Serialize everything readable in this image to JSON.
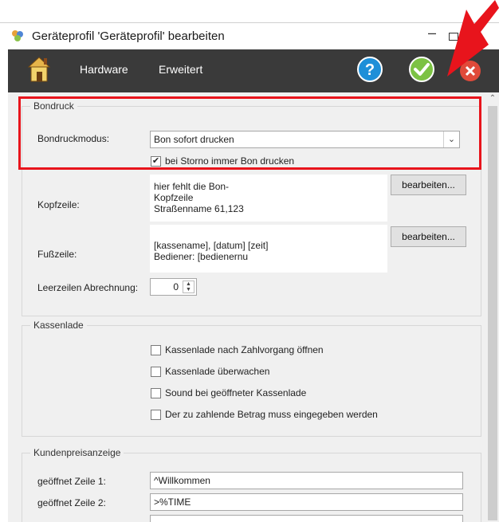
{
  "window": {
    "title": "Geräteprofil 'Geräteprofil' bearbeiten",
    "minimize_label": "–"
  },
  "toolbar": {
    "hardware_label": "Hardware",
    "erweitert_label": "Erweitert"
  },
  "bondruck": {
    "title": "Bondruck",
    "modus_label": "Bondruckmodus:",
    "modus_value": "Bon sofort drucken",
    "storno_label": "bei Storno immer Bon drucken",
    "storno_checked": "✔",
    "kopfzeile_label": "Kopfzeile:",
    "kopfzeile_lines": [
      "hier fehlt die Bon-",
      "Kopfzeile",
      "Straßenname 61,123"
    ],
    "fusszeile_label": "Fußzeile:",
    "fusszeile_lines": [
      "[kassename], [datum] [zeit]",
      "Bediener: [bedienernu"
    ],
    "edit_button_label": "bearbeiten...",
    "leerzeilen_label": "Leerzeilen Abrechnung:",
    "leerzeilen_value": "0"
  },
  "kassenlade": {
    "title": "Kassenlade",
    "options": [
      "Kassenlade nach Zahlvorgang öffnen",
      "Kassenlade überwachen",
      "Sound bei geöffneter Kassenlade",
      "Der zu zahlende Betrag muss eingegeben werden"
    ]
  },
  "kundenpreisanzeige": {
    "title": "Kundenpreisanzeige",
    "zeile1_label": "geöffnet Zeile 1:",
    "zeile1_value": "^Willkommen",
    "zeile2_label": "geöffnet Zeile 2:",
    "zeile2_value": ">%TIME"
  },
  "colors": {
    "toolbar_bg": "#3a3a3a",
    "highlight": "#e8141c",
    "help_blue": "#1e8fd8",
    "ok_green": "#7cc243",
    "content_bg": "#f0f0f0"
  },
  "icons": {
    "app": "profile-icon",
    "home": "home-icon",
    "help": "help-icon",
    "ok": "checkmark-icon",
    "close": "close-icon"
  }
}
